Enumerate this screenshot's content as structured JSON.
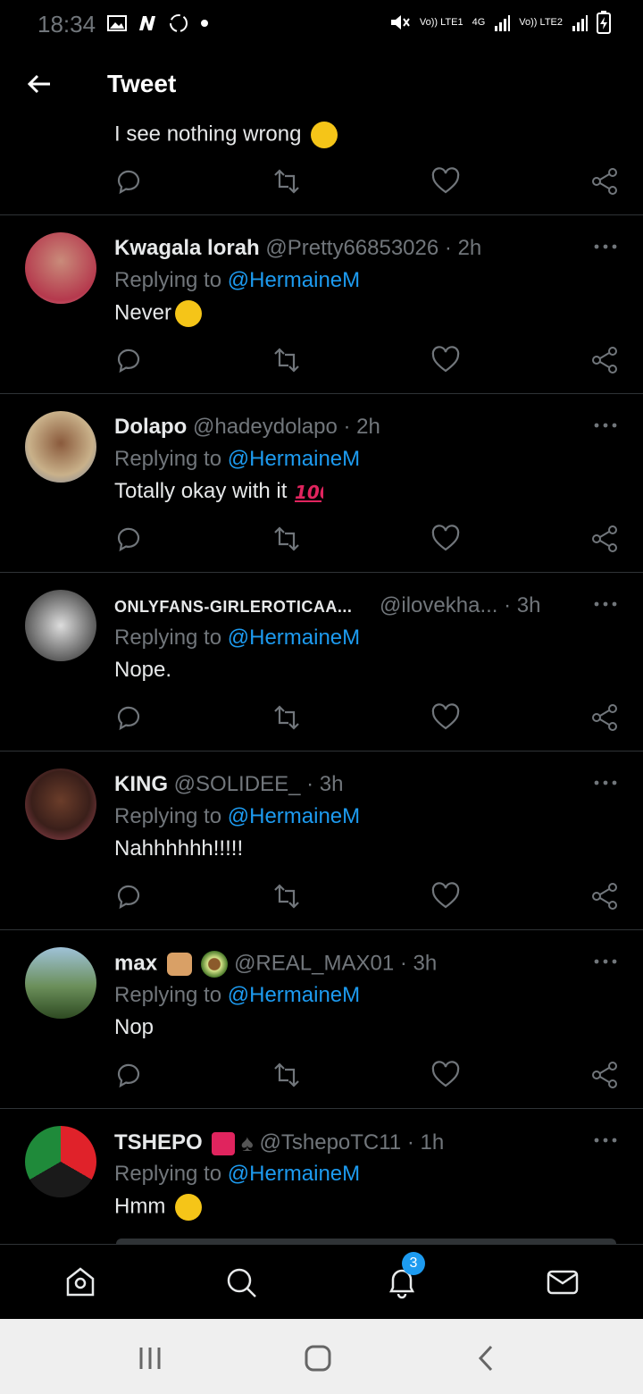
{
  "status": {
    "time": "18:34",
    "signal1": "Vo)) LTE1",
    "network": "4G",
    "signal2": "Vo)) LTE2"
  },
  "header": {
    "title": "Tweet"
  },
  "colors": {
    "bg": "#000000",
    "accent": "#1d9bf0",
    "muted": "#71767b",
    "text": "#e7e9ea"
  },
  "top_partial": {
    "text": "I see nothing wrong"
  },
  "tweets": [
    {
      "name": "Kwagala lorah",
      "handle": "@Pretty66853026",
      "time": "2h",
      "replying": "Replying to",
      "mention": "@HermaineM",
      "text": "Never"
    },
    {
      "name": "Dolapo",
      "handle": "@hadeydolapo",
      "time": "2h",
      "replying": "Replying to",
      "mention": "@HermaineM",
      "text": "Totally okay with it"
    },
    {
      "name": "ONLYFANS-GIRLEROTICAA...",
      "handle": "@ilovekha...",
      "time": "3h",
      "replying": "Replying to",
      "mention": "@HermaineM",
      "text": "Nope."
    },
    {
      "name": "KING",
      "handle": "@SOLIDEE_",
      "time": "3h",
      "replying": "Replying to",
      "mention": "@HermaineM",
      "text": "Nahhhhhh!!!!!"
    },
    {
      "name": "max",
      "handle": "@REAL_MAX01",
      "time": "3h",
      "replying": "Replying to",
      "mention": "@HermaineM",
      "text": "Nop"
    },
    {
      "name": "TSHEPO",
      "handle": "@TshepoTC11",
      "time": "1h",
      "replying": "Replying to",
      "mention": "@HermaineM",
      "text": "Hmm"
    }
  ],
  "separator": "·",
  "nav": {
    "notifications_badge": "3"
  },
  "icons": [
    "back-arrow-icon",
    "reply-icon",
    "retweet-icon",
    "like-icon",
    "share-icon",
    "more-icon",
    "home-icon",
    "search-icon",
    "notifications-icon",
    "messages-icon"
  ]
}
